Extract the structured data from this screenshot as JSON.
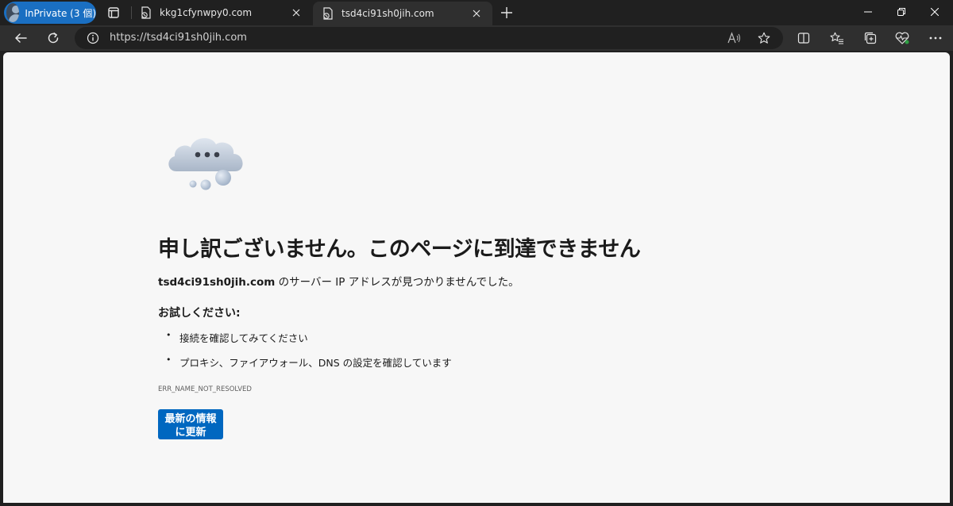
{
  "tabstrip": {
    "profile_label": "InPrivate (3 個)",
    "tabs": [
      {
        "title": "kkg1cfynwpy0.com"
      },
      {
        "title": "tsd4ci91sh0jih.com"
      }
    ]
  },
  "toolbar": {
    "url": "https://tsd4ci91sh0jih.com"
  },
  "page": {
    "heading": "申し訳ございません。このページに到達できません",
    "detail_host": "tsd4ci91sh0jih.com",
    "detail_text": " のサーバー IP アドレスが見つかりませんでした。",
    "try_heading": "お試しください:",
    "suggestions": [
      "接続を確認してみてください",
      "プロキシ、ファイアウォール、DNS の設定を確認しています"
    ],
    "error_code": "ERR_NAME_NOT_RESOLVED",
    "refresh_button_line1": "最新の情報",
    "refresh_button_line2": "に更新"
  },
  "colors": {
    "accent": "#0067c0",
    "profile_pill": "#1a6fc2",
    "tabstrip_bg": "#202020",
    "toolbar_bg": "#2f2f2f",
    "page_bg": "#f7f7f7"
  },
  "icons": {
    "tab_actions": "tab-actions-icon",
    "favicon": "page-error-favicon",
    "close": "close-icon",
    "new_tab": "plus-icon",
    "back": "back-arrow-icon",
    "refresh": "refresh-icon",
    "site_info": "info-icon",
    "read_aloud": "read-aloud-icon",
    "favorite": "star-icon",
    "split_screen": "split-screen-icon",
    "favorites": "favorites-list-icon",
    "collections": "collections-icon",
    "performance": "heart-pulse-icon",
    "menu": "more-icon",
    "hero": "cloud-thinking-icon"
  }
}
